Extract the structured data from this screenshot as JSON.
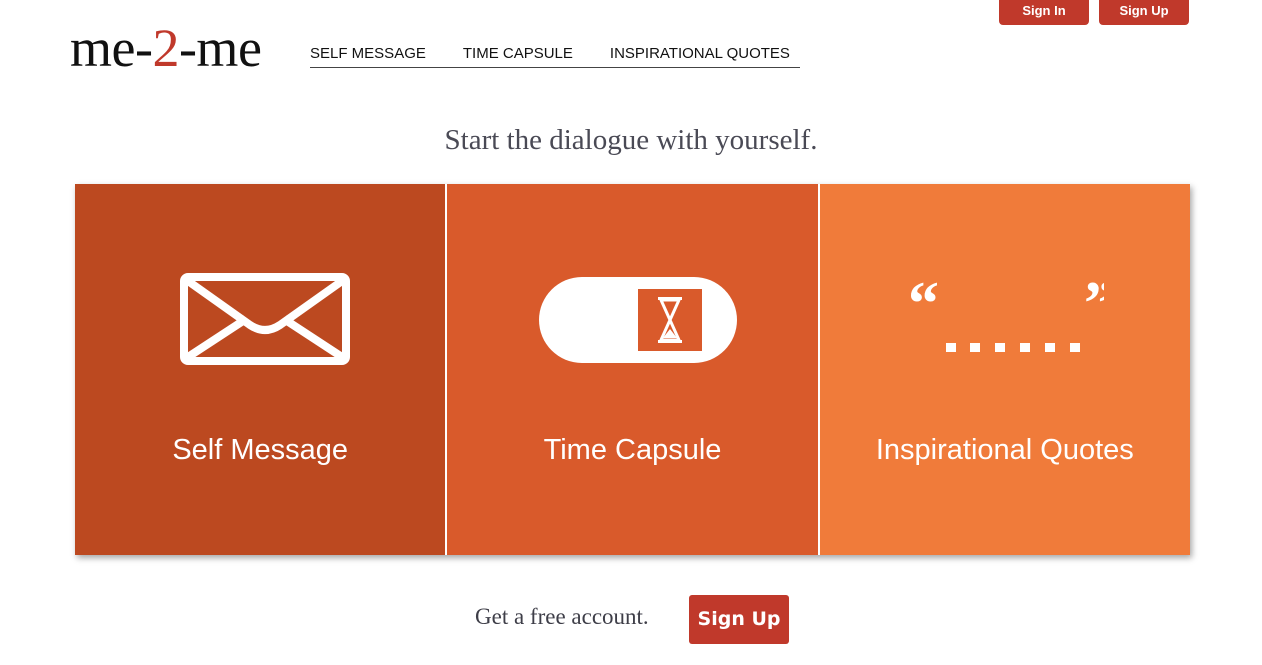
{
  "header": {
    "sign_in_label": "Sign In",
    "sign_up_label": "Sign Up",
    "logo": {
      "part1": "me-",
      "part2": "2",
      "part3": "-me"
    }
  },
  "nav": {
    "items": [
      "SELF MESSAGE",
      "TIME CAPSULE",
      "INSPIRATIONAL QUOTES"
    ]
  },
  "hero": {
    "tagline": "Start the dialogue with yourself."
  },
  "tiles": [
    {
      "label": "Self Message",
      "icon": "envelope-icon",
      "color": "#bc4920"
    },
    {
      "label": "Time Capsule",
      "icon": "capsule-hourglass-icon",
      "color": "#d95a2b"
    },
    {
      "label": "Inspirational Quotes",
      "icon": "quote-icon",
      "color": "#f07b3a"
    }
  ],
  "cta": {
    "text": "Get a free account.",
    "button_label": "Sign Up"
  },
  "colors": {
    "accent": "#c0392b",
    "text_dark": "#111111",
    "text_muted": "#4a4a55"
  }
}
